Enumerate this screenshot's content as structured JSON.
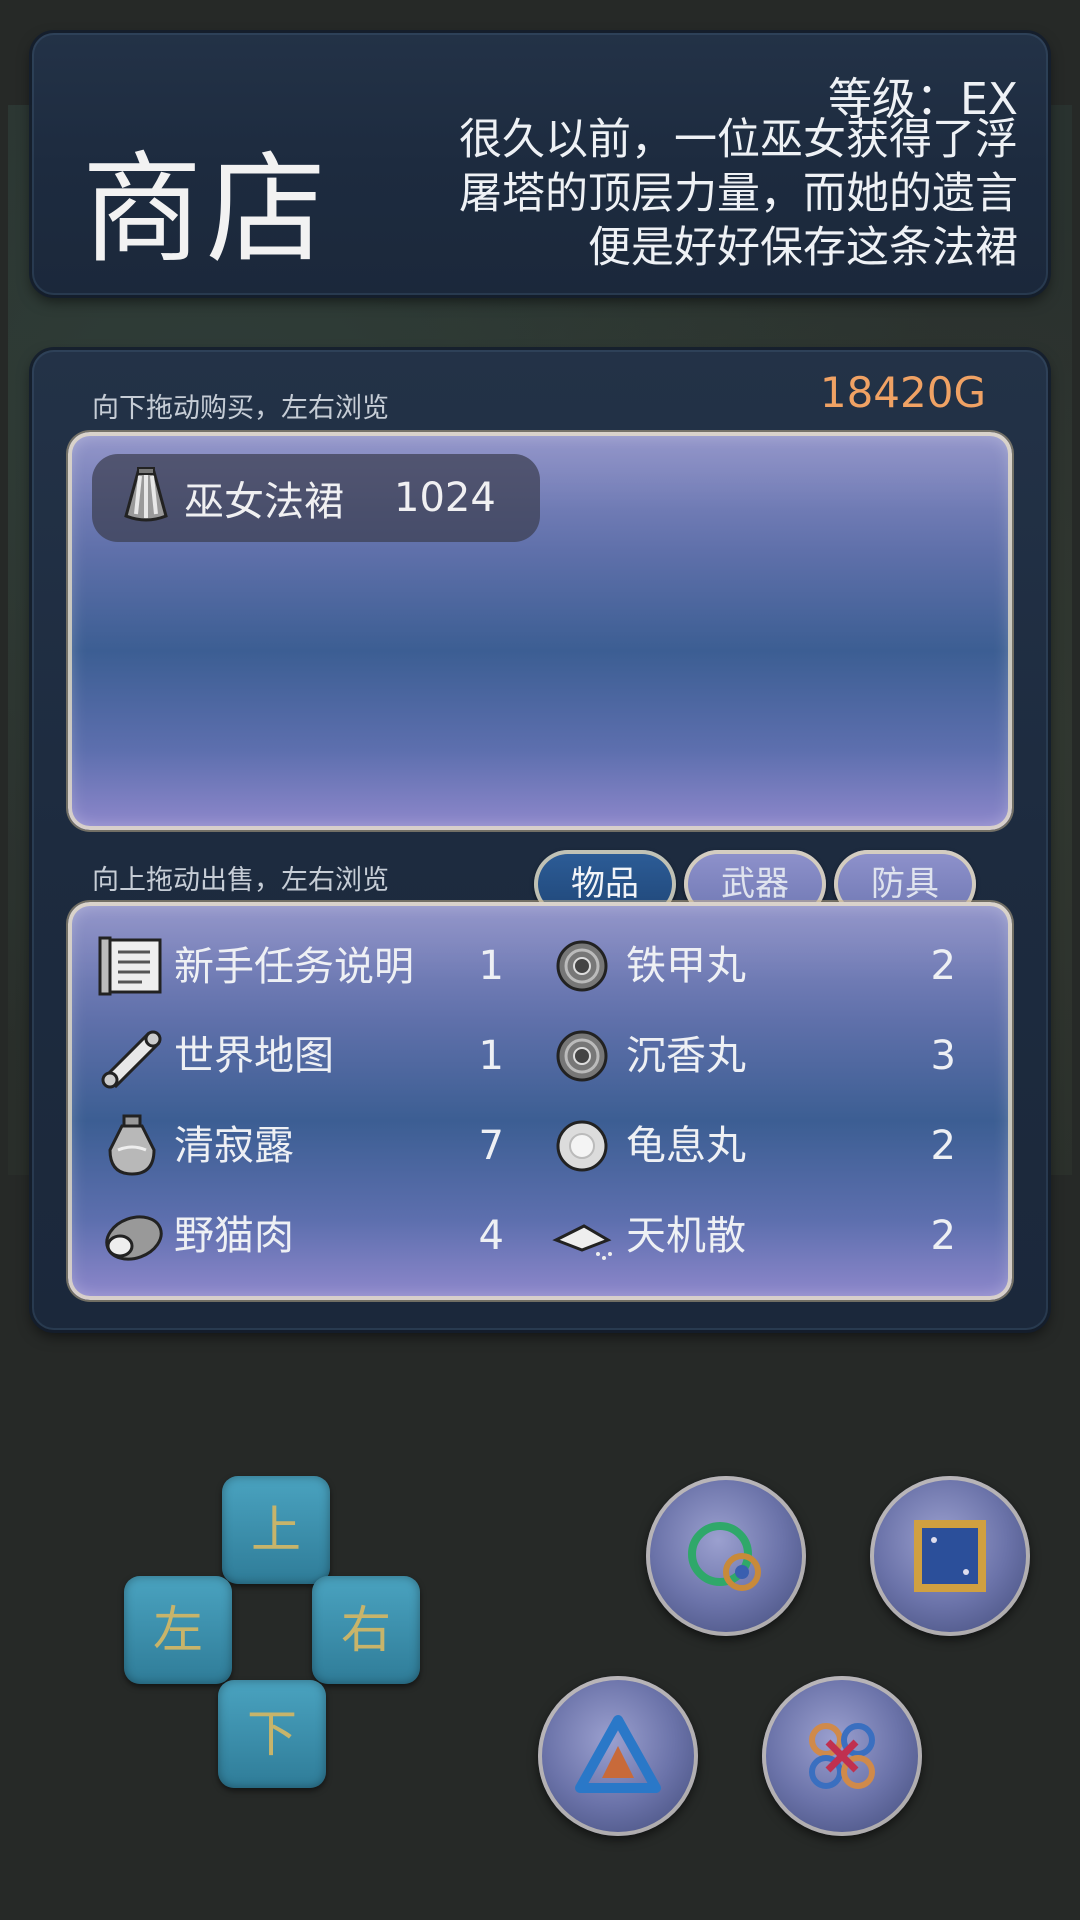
{
  "header": {
    "title": "商店",
    "level": "等级：EX",
    "description": "很久以前，一位巫女获得了浮屠塔的顶层力量，而她的遗言便是好好保存这条法裙"
  },
  "shop": {
    "buy_hint": "向下拖动购买，左右浏览",
    "gold": "18420G",
    "buy_items": [
      {
        "name": "巫女法裙",
        "price": "1024",
        "icon": "skirt-icon"
      }
    ],
    "sell_hint": "向上拖动出售，左右浏览",
    "tabs": [
      {
        "label": "物品",
        "active": true
      },
      {
        "label": "武器",
        "active": false
      },
      {
        "label": "防具",
        "active": false
      }
    ],
    "inventory": [
      {
        "name": "新手任务说明",
        "qty": "1",
        "icon": "scroll-icon"
      },
      {
        "name": "铁甲丸",
        "qty": "2",
        "icon": "dark-pill-icon"
      },
      {
        "name": "世界地图",
        "qty": "1",
        "icon": "map-icon"
      },
      {
        "name": "沉香丸",
        "qty": "3",
        "icon": "dark-pill-icon"
      },
      {
        "name": "清寂露",
        "qty": "7",
        "icon": "potion-icon"
      },
      {
        "name": "龟息丸",
        "qty": "2",
        "icon": "light-pill-icon"
      },
      {
        "name": "野猫肉",
        "qty": "4",
        "icon": "meat-icon"
      },
      {
        "name": "天机散",
        "qty": "2",
        "icon": "powder-icon"
      }
    ]
  },
  "controls": {
    "up": "上",
    "down": "下",
    "left": "左",
    "right": "右"
  }
}
